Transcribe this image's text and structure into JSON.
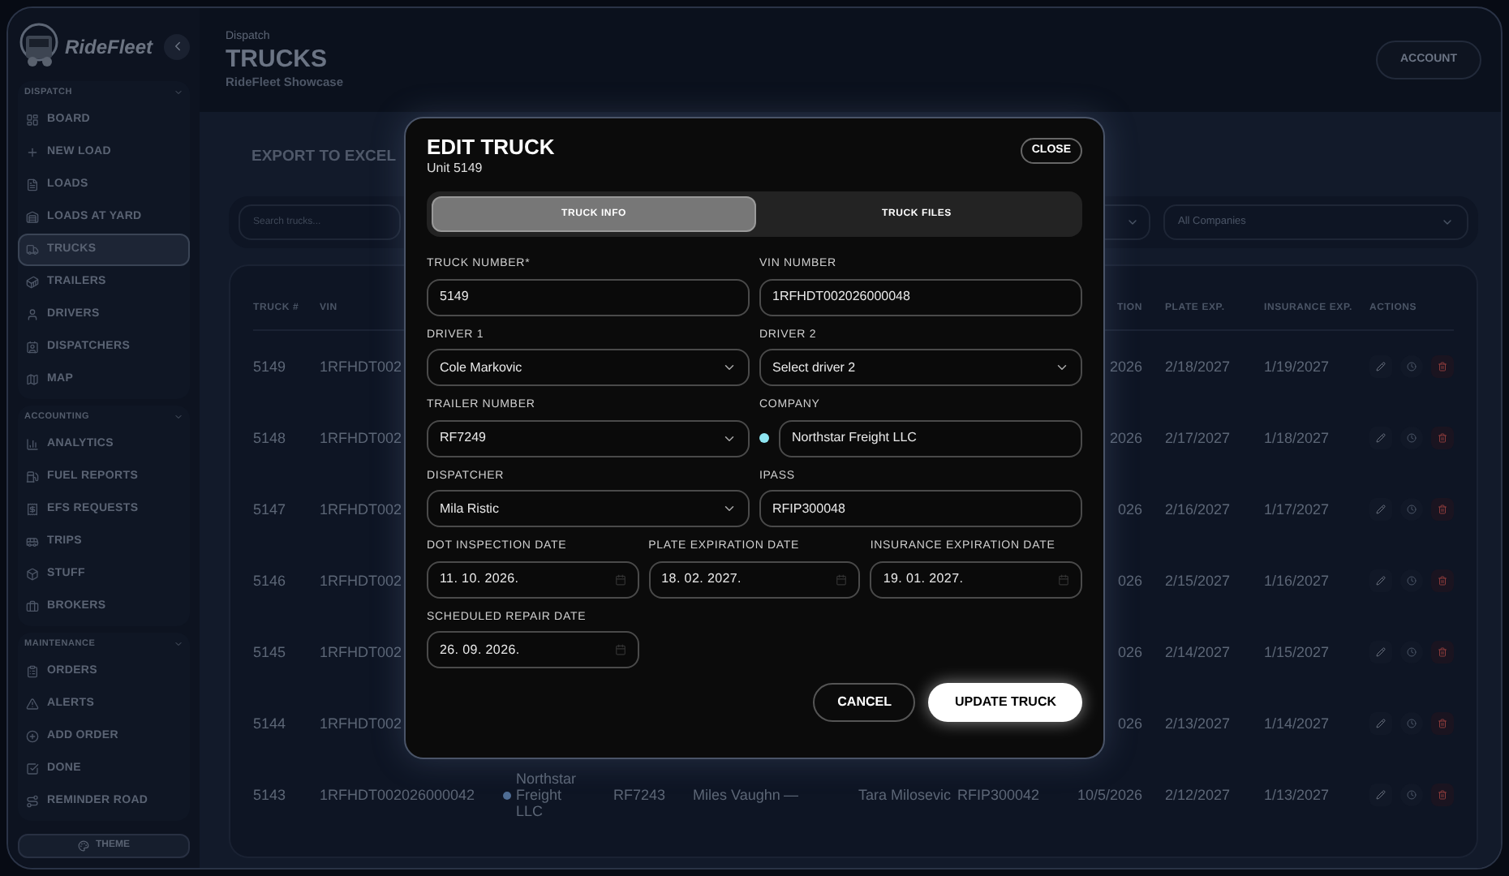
{
  "sidebar": {
    "brand": "RideFleet",
    "sections": [
      {
        "title": "DISPATCH",
        "expanded": true,
        "items": [
          {
            "label": "BOARD",
            "selected": false
          },
          {
            "label": "NEW LOAD",
            "selected": false
          },
          {
            "label": "LOADS",
            "selected": false
          },
          {
            "label": "LOADS AT YARD",
            "selected": false
          },
          {
            "label": "TRUCKS",
            "selected": true
          },
          {
            "label": "TRAILERS",
            "selected": false
          },
          {
            "label": "DRIVERS",
            "selected": false
          },
          {
            "label": "DISPATCHERS",
            "selected": false
          },
          {
            "label": "MAP",
            "selected": false
          }
        ]
      },
      {
        "title": "ACCOUNTING",
        "expanded": true,
        "items": [
          {
            "label": "ANALYTICS",
            "selected": false
          },
          {
            "label": "FUEL REPORTS",
            "selected": false
          },
          {
            "label": "EFS REQUESTS",
            "selected": false
          },
          {
            "label": "TRIPS",
            "selected": false
          },
          {
            "label": "STUFF",
            "selected": false
          },
          {
            "label": "BROKERS",
            "selected": false
          }
        ]
      },
      {
        "title": "MAINTENANCE",
        "expanded": true,
        "items": [
          {
            "label": "ORDERS",
            "selected": false
          },
          {
            "label": "ALERTS",
            "selected": false
          },
          {
            "label": "ADD ORDER",
            "selected": false
          },
          {
            "label": "DONE",
            "selected": false
          },
          {
            "label": "REMINDER ROAD",
            "selected": false
          }
        ]
      }
    ],
    "theme_button": "THEME"
  },
  "header": {
    "breadcrumb": "Dispatch",
    "title": "TRUCKS",
    "subtitle": "RideFleet Showcase",
    "account_button": "ACCOUNT"
  },
  "toolbar": {
    "export_button": "EXPORT TO EXCEL",
    "search": {
      "placeholder": "Search trucks..."
    },
    "company_filter": "All Companies"
  },
  "table": {
    "columns": {
      "truck": "TRUCK #",
      "vin": "VIN",
      "dot_inspection": "TION",
      "plate_exp": "PLATE EXP.",
      "insurance_exp": "INSURANCE EXP.",
      "actions": "ACTIONS"
    },
    "rows": [
      {
        "truck": "5149",
        "vin": "1RFHDT002",
        "dot_inspection": "2026",
        "plate_exp": "2/18/2027",
        "insurance_exp": "1/19/2027"
      },
      {
        "truck": "5148",
        "vin": "1RFHDT002",
        "dot_inspection": "2026",
        "plate_exp": "2/17/2027",
        "insurance_exp": "1/18/2027"
      },
      {
        "truck": "5147",
        "vin": "1RFHDT002",
        "dot_inspection": "026",
        "plate_exp": "2/16/2027",
        "insurance_exp": "1/17/2027"
      },
      {
        "truck": "5146",
        "vin": "1RFHDT002",
        "dot_inspection": "026",
        "plate_exp": "2/15/2027",
        "insurance_exp": "1/16/2027"
      },
      {
        "truck": "5145",
        "vin": "1RFHDT002",
        "dot_inspection": "026",
        "plate_exp": "2/14/2027",
        "insurance_exp": "1/15/2027"
      },
      {
        "truck": "5144",
        "vin": "1RFHDT002",
        "dot_inspection": "026",
        "plate_exp": "2/13/2027",
        "insurance_exp": "1/14/2027"
      },
      {
        "truck": "5143",
        "vin": "1RFHDT002026000042",
        "company": "Northstar Freight LLC",
        "color": "#4f6d94",
        "trailer": "RF7243",
        "driver_1": "Miles Vaughn",
        "driver_2": "—",
        "dispatcher": "Tara Milosevic",
        "ipass": "RFIP300042",
        "dot_inspection": "10/5/2026",
        "plate_exp": "2/12/2027",
        "insurance_exp": "1/13/2027"
      }
    ]
  },
  "modal": {
    "title": "EDIT TRUCK",
    "subtitle": "Unit 5149",
    "close_button": "CLOSE",
    "tabs": [
      {
        "label": "TRUCK INFO",
        "selected": true
      },
      {
        "label": "TRUCK FILES",
        "selected": false
      }
    ],
    "field_rows": [
      [
        {
          "label": "TRUCK NUMBER*",
          "kind": "text",
          "value": "5149"
        },
        {
          "label": "VIN NUMBER",
          "kind": "text",
          "value": "1RFHDT002026000048"
        }
      ],
      [
        {
          "label": "DRIVER 1",
          "kind": "select",
          "value": "Cole Markovic"
        },
        {
          "label": "DRIVER 2",
          "kind": "select",
          "value": "Select driver 2"
        }
      ],
      [
        {
          "label": "TRAILER NUMBER",
          "kind": "select",
          "value": "RF7249"
        },
        {
          "label": "COMPANY",
          "kind": "company",
          "value": "Northstar Freight LLC",
          "color": "#8ee6f2"
        }
      ],
      [
        {
          "label": "DISPATCHER",
          "kind": "select",
          "value": "Mila Ristic"
        },
        {
          "label": "IPASS",
          "kind": "text",
          "value": "RFIP300048"
        }
      ],
      [
        {
          "label": "DOT INSPECTION DATE",
          "kind": "date",
          "value": "11. 10. 2026."
        },
        {
          "label": "PLATE EXPIRATION DATE",
          "kind": "date",
          "value": "18. 02. 2027."
        },
        {
          "label": "INSURANCE EXPIRATION DATE",
          "kind": "date",
          "value": "19. 01. 2027."
        }
      ],
      [
        {
          "label": "SCHEDULED REPAIR DATE",
          "kind": "date",
          "value": "26. 09. 2026."
        }
      ]
    ],
    "cancel_button": "CANCEL",
    "submit_button": "UPDATE TRUCK"
  }
}
